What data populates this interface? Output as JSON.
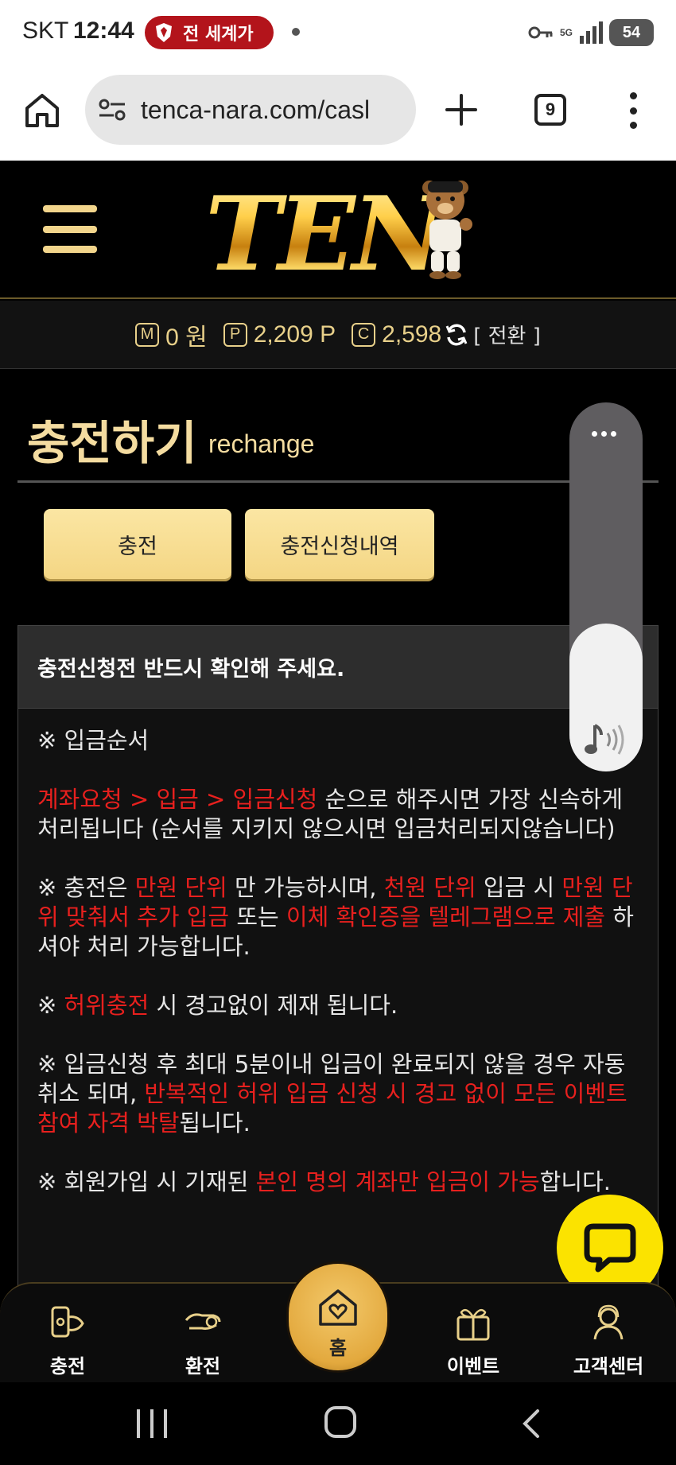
{
  "status_bar": {
    "carrier": "SKT",
    "time": "12:44",
    "alert_pill": "전 세계가",
    "network": "5G",
    "battery": "54"
  },
  "browser": {
    "url": "tenca-nara.com/casl",
    "tab_count": "9"
  },
  "site": {
    "logo_text": "TEN",
    "balance": {
      "money_badge": "M",
      "money": "0 원",
      "point_badge": "P",
      "point": "2,209 P",
      "coin_badge": "C",
      "coin": "2,598",
      "switch_label": "[ 전환 ]"
    }
  },
  "page": {
    "title": "충전하기",
    "subtitle": "rechange",
    "tabs": [
      {
        "label": "충전"
      },
      {
        "label": "충전신청내역"
      }
    ]
  },
  "notice": {
    "heading": "충전신청전 반드시 확인해 주세요.",
    "section_title": "※ 입금순서",
    "p1_red": "계좌요청 > 입금 > 입금신청",
    "p1_rest": " 순으로 해주시면 가장 신속하게 처리됩니다 (순서를 지키지 않으시면 입금처리되지않습니다)",
    "p2_a": "※ 충전은 ",
    "p2_b": "만원 단위",
    "p2_c": " 만 가능하시며, ",
    "p2_d": "천원 단위",
    "p2_e": " 입금 시 ",
    "p2_f": "만원 단위 맞춰서 추가 입금",
    "p2_g": " 또는 ",
    "p2_h": "이체 확인증을 텔레그램으로 제출",
    "p2_i": " 하셔야 처리 가능합니다.",
    "p3_a": "※ ",
    "p3_b": "허위충전",
    "p3_c": " 시 경고없이 제재 됩니다.",
    "p4_a": "※ 입금신청 후 최대 5분이내 입금이 완료되지 않을 경우 자동 취소 되며, ",
    "p4_b": "반복적인 허위 입금 신청 시 경고 없이 모든 이벤트 참여 자격 박탈",
    "p4_c": "됩니다.",
    "p5_a": "※ 회원가입 시 기재된 ",
    "p5_b": "본인 명의 계좌만 입금이 가능",
    "p5_c": "합니다."
  },
  "bottom_nav": [
    {
      "label": "충전",
      "icon": "charge-icon"
    },
    {
      "label": "환전",
      "icon": "exchange-icon"
    },
    {
      "label": "홈",
      "icon": "home-heart-icon"
    },
    {
      "label": "이벤트",
      "icon": "gift-icon"
    },
    {
      "label": "고객센터",
      "icon": "support-icon"
    }
  ],
  "colors": {
    "accent_gold": "#f4d684",
    "notice_red": "#e8201e",
    "chat_yellow": "#fbe300"
  }
}
